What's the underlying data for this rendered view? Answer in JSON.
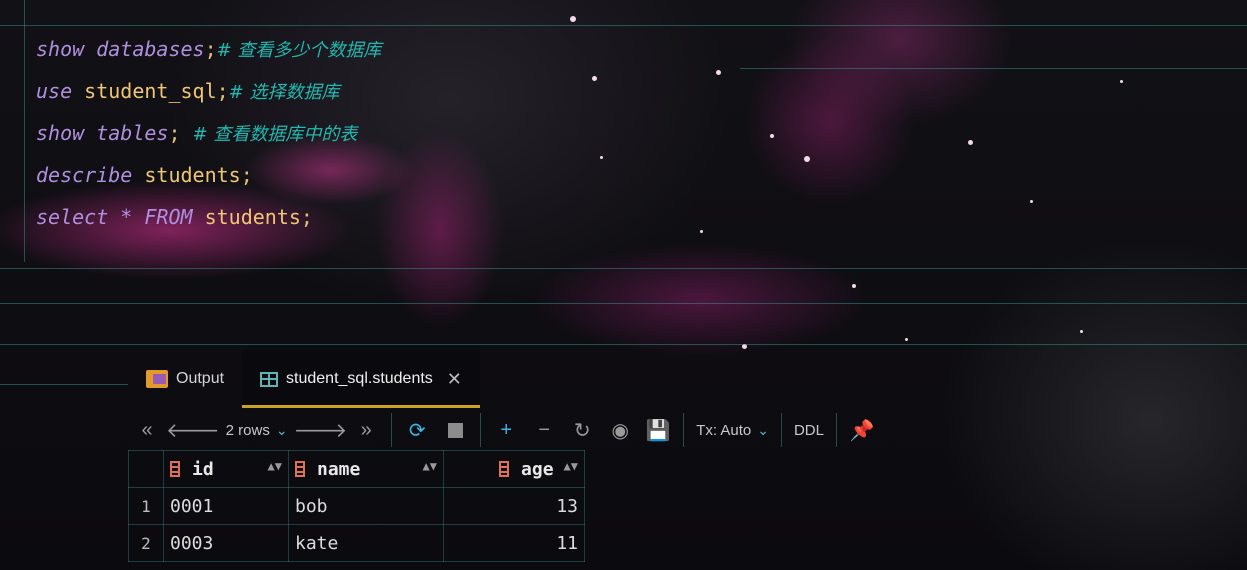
{
  "editor": {
    "lines": [
      {
        "kw": "show databases",
        "id": "",
        "punct": ";",
        "comment": "# 查看多少个数据库"
      },
      {
        "kw": "use ",
        "id": "student_sql",
        "punct": ";",
        "comment": "# 选择数据库"
      },
      {
        "kw": "show tables",
        "id": "",
        "punct": "; ",
        "comment": "# 查看数据库中的表"
      },
      {
        "kw": "describe ",
        "id": "students",
        "punct": ";",
        "comment": ""
      },
      {
        "kw": "select * FROM ",
        "id": "students",
        "punct": ";",
        "comment": ""
      }
    ]
  },
  "tabs": {
    "output_label": "Output",
    "table_label": "student_sql.students"
  },
  "toolbar": {
    "rows_label": "2 rows",
    "tx_label": "Tx: Auto",
    "ddl_label": "DDL"
  },
  "grid": {
    "columns": [
      "id",
      "name",
      "age"
    ],
    "rows": [
      {
        "num": "1",
        "id": "0001",
        "name": "bob",
        "age": "13"
      },
      {
        "num": "2",
        "id": "0003",
        "name": "kate",
        "age": "11"
      }
    ]
  },
  "colors": {
    "accent_tab": "#c9a227",
    "keyword": "#b18fe0",
    "identifier": "#f0c674",
    "comment": "#22b8b0",
    "grid_line": "#3ca0a0"
  }
}
